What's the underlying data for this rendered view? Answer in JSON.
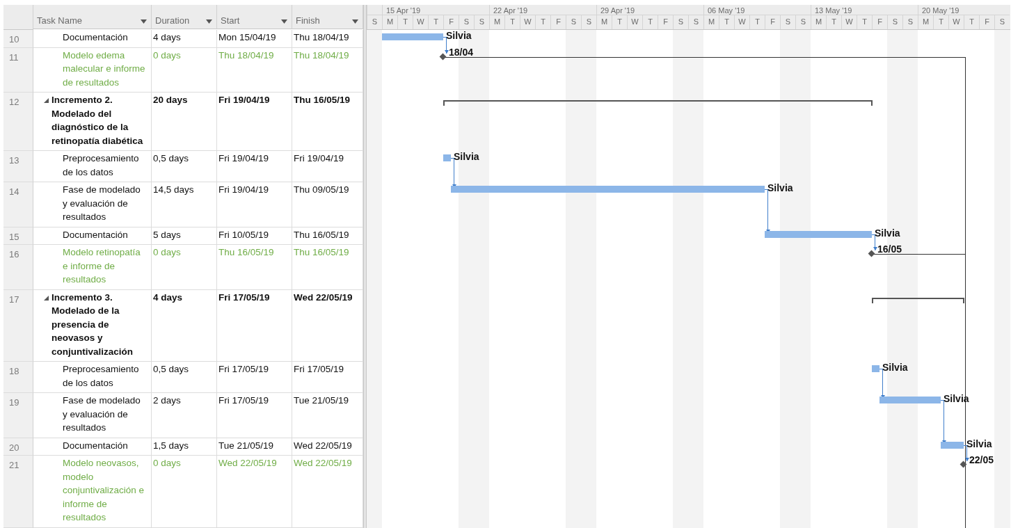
{
  "table": {
    "columns": [
      {
        "label": "Task Name"
      },
      {
        "label": "Duration"
      },
      {
        "label": "Start"
      },
      {
        "label": "Finish"
      }
    ],
    "rows": [
      {
        "id": "10",
        "kind": "task",
        "name": "Documentación",
        "duration": "4 days",
        "start": "Mon 15/04/19",
        "finish": "Thu 18/04/19",
        "bar_label": "Silvia"
      },
      {
        "id": "11",
        "kind": "milestone",
        "name": "Modelo edema malecular e informe de resultados",
        "duration": "0 days",
        "start": "Thu 18/04/19",
        "finish": "Thu 18/04/19",
        "bar_label": "18/04"
      },
      {
        "id": "12",
        "kind": "summary",
        "expanded": true,
        "name": "Incremento 2. Modelado del diagnóstico de la retinopatía diabética",
        "duration": "20 days",
        "start": "Fri 19/04/19",
        "finish": "Thu 16/05/19",
        "children": [
          {
            "id": "13",
            "kind": "task",
            "name": "Preprocesamiento de los datos",
            "duration": "0,5 days",
            "start": "Fri 19/04/19",
            "finish": "Fri 19/04/19",
            "bar_label": "Silvia"
          },
          {
            "id": "14",
            "kind": "task",
            "name": "Fase de modelado y evaluación de resultados",
            "duration": "14,5 days",
            "start": "Fri 19/04/19",
            "finish": "Thu 09/05/19",
            "bar_label": "Silvia"
          },
          {
            "id": "15",
            "kind": "task",
            "name": "Documentación",
            "duration": "5 days",
            "start": "Fri 10/05/19",
            "finish": "Thu 16/05/19",
            "bar_label": "Silvia"
          },
          {
            "id": "16",
            "kind": "milestone",
            "name": "Modelo retinopatía e informe de resultados",
            "duration": "0 days",
            "start": "Thu 16/05/19",
            "finish": "Thu 16/05/19",
            "bar_label": "16/05"
          }
        ]
      },
      {
        "id": "17",
        "kind": "summary",
        "expanded": true,
        "name": "Incremento 3. Modelado de la presencia de neovasos y conjuntivalización",
        "duration": "4 days",
        "start": "Fri 17/05/19",
        "finish": "Wed 22/05/19",
        "children": [
          {
            "id": "18",
            "kind": "task",
            "name": "Preprocesamiento de los datos",
            "duration": "0,5 days",
            "start": "Fri 17/05/19",
            "finish": "Fri 17/05/19",
            "bar_label": "Silvia"
          },
          {
            "id": "19",
            "kind": "task",
            "name": "Fase de modelado y evaluación de resultados",
            "duration": "2 days",
            "start": "Fri 17/05/19",
            "finish": "Tue 21/05/19",
            "bar_label": "Silvia"
          },
          {
            "id": "20",
            "kind": "task",
            "name": "Documentación",
            "duration": "1,5 days",
            "start": "Tue 21/05/19",
            "finish": "Wed 22/05/19",
            "bar_label": "Silvia"
          },
          {
            "id": "21",
            "kind": "milestone",
            "name": "Modelo neovasos, modelo conjuntivalización e informe de resultados",
            "duration": "0 days",
            "start": "Wed 22/05/19",
            "finish": "Wed 22/05/19",
            "bar_label": "22/05"
          }
        ]
      }
    ]
  },
  "timeline": {
    "weeks": [
      "15 Apr '19",
      "22 Apr '19",
      "29 Apr '19",
      "06 May '19",
      "13 May '19",
      "20 May '19"
    ],
    "days": [
      "S",
      "M",
      "T",
      "W",
      "T",
      "F",
      "S",
      "S",
      "M",
      "T",
      "W",
      "T",
      "F",
      "S",
      "S",
      "M",
      "T",
      "W",
      "T",
      "F",
      "S",
      "S",
      "M",
      "T",
      "W",
      "T",
      "F",
      "S",
      "S",
      "M",
      "T",
      "W",
      "T",
      "F",
      "S",
      "S",
      "M",
      "T",
      "W",
      "T",
      "F",
      "S"
    ]
  }
}
